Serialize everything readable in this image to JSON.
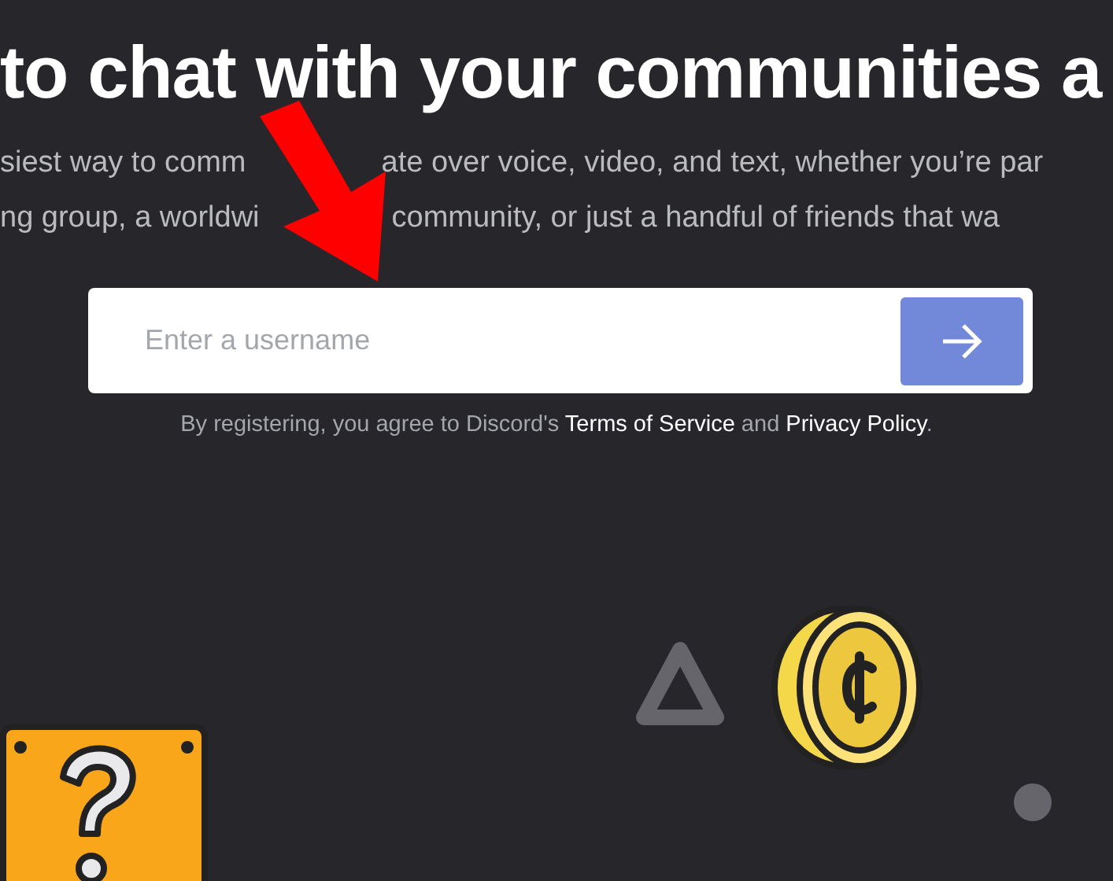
{
  "headline": "to chat with your communities a",
  "subtitle_lines": [
    [
      "siest way to comm",
      "ate over voice, video, and text, whether you’re par"
    ],
    [
      "ng group, a worldwi",
      "community, or just a handful of friends that wa"
    ]
  ],
  "username_field": {
    "placeholder": "Enter a username"
  },
  "terms": {
    "prefix": "By registering, you agree to Discord's",
    "first_link": "Terms of Service",
    "joiner": "and",
    "second_link": "Privacy Policy",
    "suffix": "."
  }
}
